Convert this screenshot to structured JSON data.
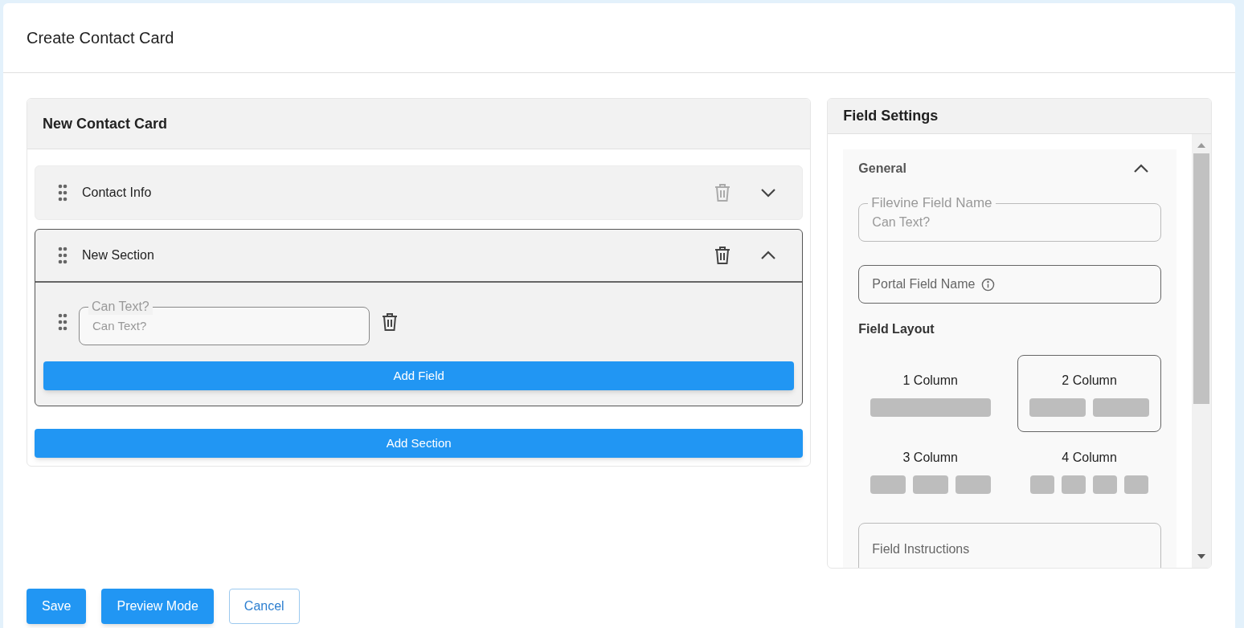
{
  "page": {
    "title": "Create Contact Card"
  },
  "card": {
    "title": "New Contact Card",
    "sections": [
      {
        "title": "Contact Info",
        "expanded": false
      },
      {
        "title": "New Section",
        "expanded": true,
        "fields": [
          {
            "label": "Can Text?",
            "value": "Can Text?"
          }
        ],
        "add_field": "Add Field"
      }
    ],
    "add_section": "Add Section"
  },
  "settings": {
    "title": "Field Settings",
    "group": {
      "title": "General",
      "expanded": true,
      "filevine_field": {
        "label": "Filevine Field Name",
        "value": "Can Text?"
      },
      "portal_field": {
        "placeholder": "Portal Field Name"
      },
      "layout_title": "Field Layout",
      "layouts": [
        {
          "label": "1 Column",
          "selected": false
        },
        {
          "label": "2 Column",
          "selected": true
        },
        {
          "label": "3 Column",
          "selected": false
        },
        {
          "label": "4 Column",
          "selected": false
        }
      ],
      "instructions": {
        "placeholder": "Field Instructions"
      }
    }
  },
  "buttons": [
    {
      "label": "Save",
      "kind": "primary"
    },
    {
      "label": "Preview Mode",
      "kind": "primary"
    },
    {
      "label": "Cancel",
      "kind": "outline"
    }
  ]
}
